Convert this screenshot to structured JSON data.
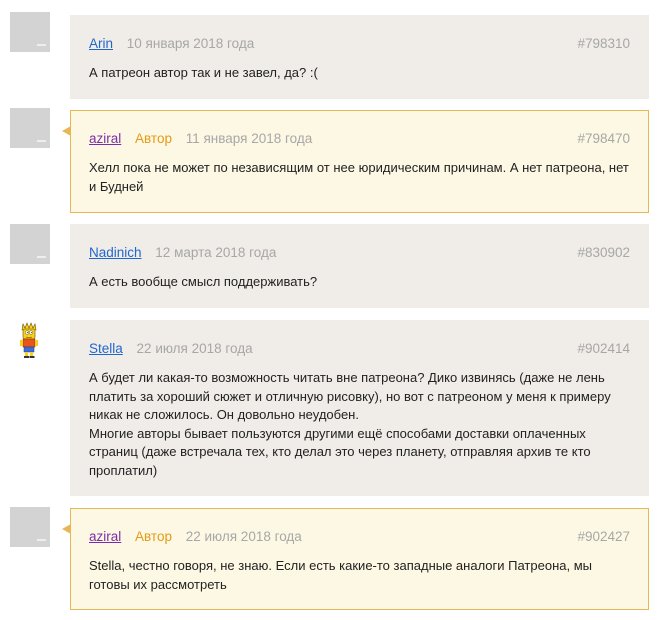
{
  "comments": [
    {
      "author": "Arin",
      "role": "",
      "date": "10 января 2018 года",
      "id": "#798310",
      "lines": [
        "А патреон автор так и не завел, да? :("
      ]
    },
    {
      "author": "aziral",
      "role": "Автор",
      "date": "11 января 2018 года",
      "id": "#798470",
      "lines": [
        "Хелл пока не может по независящим от нее юридическим причинам. А нет патреона, нет",
        "и Будней"
      ]
    },
    {
      "author": "Nadinich",
      "role": "",
      "date": "12 марта 2018 года",
      "id": "#830902",
      "lines": [
        "А есть вообще смысл поддерживать?"
      ]
    },
    {
      "author": "Stella",
      "role": "",
      "date": "22 июля 2018 года",
      "id": "#902414",
      "lines": [
        "А будет ли какая-то возможность читать вне патреона? Дико извинясь (даже не лень",
        "платить за хороший сюжет и отличную рисовку), но вот с патреоном у меня к примеру",
        "никак не сложилось. Он довольно неудобен.",
        "Многие авторы бывает пользуются другими ещё способами доставки оплаченных",
        "страниц (даже встречала тех, кто делал это через планету, отправляя архив те кто",
        "проплатил)"
      ]
    },
    {
      "author": "aziral",
      "role": "Автор",
      "date": "22 июля 2018 года",
      "id": "#902427",
      "lines": [
        "Stella, честно говоря, не знаю. Если есть какие-то западные аналоги Патреона, мы",
        "готовы их рассмотреть"
      ]
    }
  ],
  "colors": {
    "link": "#2166cc",
    "author_link": "#7a2ea8",
    "author_badge": "#e39a16",
    "meta_gray": "#a7a7a7",
    "comment_bg": "#f0ede8",
    "author_bg": "#fdf8e4",
    "author_border": "#e7b655"
  },
  "avatars": [
    "default-avatar-icon",
    "default-avatar-icon",
    "default-avatar-icon",
    "bart-simpson-avatar",
    "default-avatar-icon"
  ]
}
